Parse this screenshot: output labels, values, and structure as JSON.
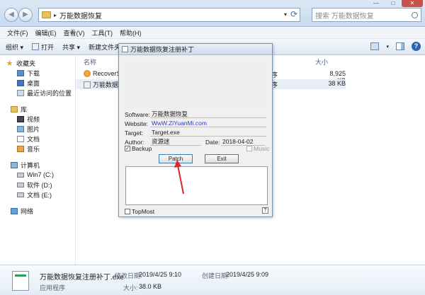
{
  "window": {
    "breadcrumb": "万能数据恢复",
    "search_placeholder": "搜索 万能数据恢复",
    "controls": {
      "min": "—",
      "max": "□",
      "close": "✕"
    }
  },
  "menu": [
    "文件(F)",
    "编辑(E)",
    "查看(V)",
    "工具(T)",
    "帮助(H)"
  ],
  "toolbar": {
    "organize": "组织 ▾",
    "open": "打开",
    "share": "共享 ▾",
    "burn": "新建文件夹"
  },
  "sidebar": {
    "favorites": "收藏夹",
    "fav_items": [
      "下载",
      "桌面",
      "最近访问的位置"
    ],
    "libraries": "库",
    "lib_items": [
      "视频",
      "图片",
      "文档",
      "音乐"
    ],
    "computer": "计算机",
    "drives": [
      "Win7 (C:)",
      "软件 (D:)",
      "文档 (E:)"
    ],
    "network": "网络"
  },
  "columns": {
    "name": "名称",
    "size": "大小"
  },
  "files": [
    {
      "name": "RecoverSe",
      "type": "序",
      "size": "8,925 KB",
      "icon": "app-orange-icon"
    },
    {
      "name": "万能数据",
      "type": "序",
      "size": "38 KB",
      "icon": "app-window-icon"
    }
  ],
  "details": {
    "name": "万能数据恢复注册补丁.exe",
    "type": "应用程序",
    "modified_label": "修改日期:",
    "modified": "2019/4/25 9:10",
    "created_label": "创建日期:",
    "created": "2019/4/25 9:09",
    "size_label": "大小:",
    "size": "38.0 KB"
  },
  "dialog": {
    "title": "万能数据恢复注册补丁",
    "software_label": "Software:",
    "software": "万能数据恢复",
    "website_label": "Website:",
    "website": "WwW.ZiYuanMi.com",
    "target_label": "Target:",
    "target": "Target.exe",
    "author_label": "Author:",
    "author": "资源迷",
    "date_label": "Date:",
    "date": "2018-04-02",
    "backup_label": "Backup",
    "backup_checked": true,
    "music_label": "Music",
    "patch_button": "Patch",
    "exit_button": "Exit",
    "topmost_label": "TopMost",
    "help": "?"
  },
  "annotation_color": "#d9262b"
}
